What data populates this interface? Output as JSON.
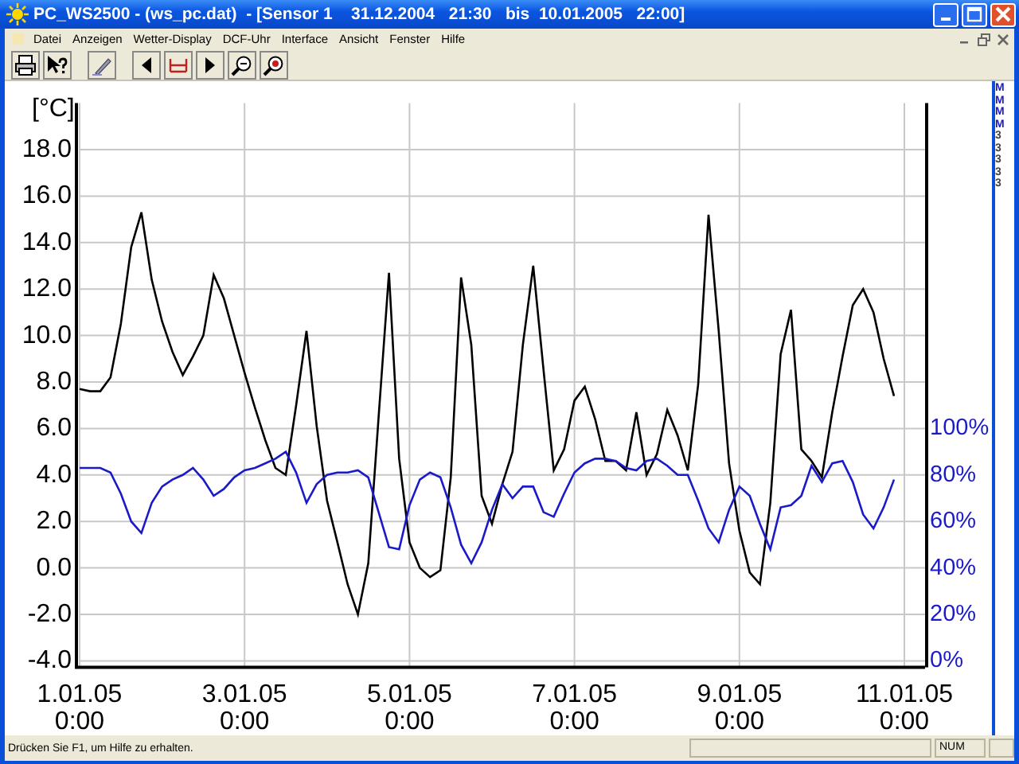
{
  "window": {
    "title": "PC_WS2500 - (ws_pc.dat)  - [Sensor 1    31.12.2004   21:30   bis  10.01.2005   22:00]"
  },
  "menu": [
    "Datei",
    "Anzeigen",
    "Wetter-Display",
    "DCF-Uhr",
    "Interface",
    "Ansicht",
    "Fenster",
    "Hilfe"
  ],
  "chart": {
    "chart_data": {
      "type": "line",
      "ylabel": "[°C]",
      "ylim": [
        -4,
        20
      ],
      "y2lim": [
        0,
        240
      ],
      "grid": true,
      "categories": [
        "1.01.05\n0:00",
        null,
        null,
        null,
        null,
        null,
        null,
        null,
        null,
        null,
        null,
        null,
        null,
        null,
        null,
        null,
        "3.01.05\n0:00",
        null,
        null,
        null,
        null,
        null,
        null,
        null,
        null,
        null,
        null,
        null,
        null,
        null,
        null,
        null,
        "5.01.05\n0:00",
        null,
        null,
        null,
        null,
        null,
        null,
        null,
        null,
        null,
        null,
        null,
        null,
        null,
        null,
        null,
        "7.01.05\n0:00",
        null,
        null,
        null,
        null,
        null,
        null,
        null,
        null,
        null,
        null,
        null,
        null,
        null,
        null,
        null,
        "9.01.05\n0:00",
        null,
        null,
        null,
        null,
        null,
        null,
        null,
        null,
        null,
        null,
        null,
        null,
        null,
        null,
        null,
        "11.01.05\n0:00"
      ],
      "yticks": [
        {
          "value": -4,
          "label": "-4.0"
        },
        {
          "value": -2,
          "label": "-2.0"
        },
        {
          "value": 0,
          "label": "0.0"
        },
        {
          "value": 2,
          "label": "2.0"
        },
        {
          "value": 4,
          "label": "4.0"
        },
        {
          "value": 6,
          "label": "6.0"
        },
        {
          "value": 8,
          "label": "8.0"
        },
        {
          "value": 10,
          "label": "10.0"
        },
        {
          "value": 12,
          "label": "12.0"
        },
        {
          "value": 14,
          "label": "14.0"
        },
        {
          "value": 16,
          "label": "16.0"
        },
        {
          "value": 18,
          "label": "18.0"
        }
      ],
      "y2ticks": [
        {
          "value": 0,
          "label": "0%"
        },
        {
          "value": 20,
          "label": "20%"
        },
        {
          "value": 40,
          "label": "40%"
        },
        {
          "value": 60,
          "label": "60%"
        },
        {
          "value": 80,
          "label": "80%"
        },
        {
          "value": 100,
          "label": "100%"
        }
      ],
      "series": [
        {
          "color": "#000000",
          "values": [
            7.7,
            7.6,
            7.6,
            8.2,
            10.5,
            13.8,
            15.3,
            12.4,
            10.6,
            9.3,
            8.3,
            9.1,
            10.0,
            12.6,
            11.6,
            10.0,
            8.4,
            6.9,
            5.5,
            4.3,
            4.0,
            7.0,
            10.2,
            6.1,
            2.9,
            1.1,
            -0.7,
            -2.0,
            0.2,
            6.5,
            12.7,
            4.7,
            1.1,
            0.0,
            -0.4,
            -0.1,
            3.9,
            12.5,
            9.6,
            3.1,
            1.9,
            3.6,
            5.0,
            9.6,
            13.0,
            8.5,
            4.2,
            5.1,
            7.2,
            7.8,
            6.4,
            4.6,
            4.6,
            4.2,
            6.7,
            4.0,
            4.9,
            6.8,
            5.7,
            4.2,
            7.9,
            15.2,
            10.2,
            4.5,
            1.6,
            -0.2,
            -0.7,
            2.8,
            9.2,
            11.1,
            5.1,
            4.6,
            3.9,
            6.7,
            9.1,
            11.3,
            12.0,
            11.0,
            9.0,
            7.4,
            null
          ]
        },
        {
          "color": "#1a1ac8",
          "axis": "y2",
          "values": [
            83,
            83,
            83,
            81,
            72,
            60,
            55,
            68,
            75,
            78,
            80,
            83,
            78,
            71,
            74,
            79,
            82,
            83,
            85,
            87,
            90,
            81,
            68,
            76,
            80,
            81,
            81,
            82,
            79,
            64,
            49,
            48,
            67,
            78,
            81,
            79,
            66,
            50,
            42,
            51,
            65,
            76,
            70,
            75,
            75,
            64,
            62,
            72,
            81,
            85,
            87,
            87,
            86,
            83,
            82,
            86,
            87,
            84,
            80,
            80,
            69,
            57,
            51,
            65,
            75,
            71,
            59,
            48,
            66,
            67,
            71,
            84,
            77,
            85,
            86,
            77,
            63,
            57,
            66,
            78,
            null
          ]
        }
      ]
    }
  },
  "side_panel": [
    "M",
    "M",
    "M",
    "M",
    "3",
    "3",
    "3",
    "3",
    "3"
  ],
  "status_bar": {
    "message": "Drücken Sie F1, um Hilfe zu erhalten.",
    "indicators": [
      "NUM"
    ]
  }
}
